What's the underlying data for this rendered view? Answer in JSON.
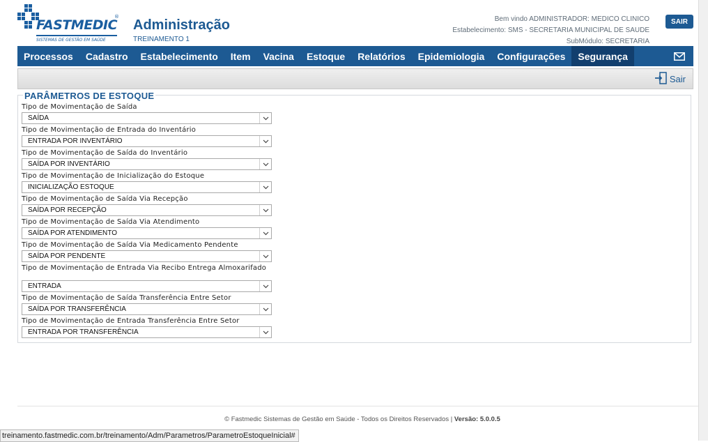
{
  "brand": {
    "logo_text": "FASTMEDIC",
    "logo_subtitle": "SISTEMAS DE GESTÃO EM SAÚDE",
    "registered": "®",
    "color": "#1a5ea0"
  },
  "header": {
    "title": "Administração",
    "subtitle": "TREINAMENTO 1",
    "welcome": "Bem vindo ADMINISTRADOR: MEDICO CLINICO",
    "establishment": "Estabelecimento: SMS - SECRETARIA MUNICIPAL DE SAUDE",
    "submodule": "SubMódulo: SECRETARIA",
    "logout_label": "SAIR"
  },
  "nav": {
    "items": [
      {
        "label": "Processos"
      },
      {
        "label": "Cadastro"
      },
      {
        "label": "Estabelecimento"
      },
      {
        "label": "Item"
      },
      {
        "label": "Vacina"
      },
      {
        "label": "Estoque"
      },
      {
        "label": "Relatórios"
      },
      {
        "label": "Epidemiologia"
      },
      {
        "label": "Configurações"
      },
      {
        "label": "Segurança",
        "active": true
      }
    ],
    "mail_icon": "envelope-icon"
  },
  "toolbar": {
    "exit_label": "Sair",
    "exit_icon": "exit-door-icon"
  },
  "panel": {
    "title": "PARÂMETROS DE ESTOQUE",
    "fields": [
      {
        "label": "Tipo de Movimentação de Saída",
        "value": "SAÍDA"
      },
      {
        "label": "Tipo de Movimentação de Entrada do Inventário",
        "value": "ENTRADA POR INVENTÁRIO"
      },
      {
        "label": "Tipo de Movimentação de Saída do Inventário",
        "value": "SAÍDA POR INVENTÁRIO"
      },
      {
        "label": "Tipo de Movimentação de Inicialização do Estoque",
        "value": "INICIALIZAÇÃO ESTOQUE"
      },
      {
        "label": "Tipo de Movimentação de Saída Via Recepção",
        "value": "SAÍDA POR RECEPÇÃO"
      },
      {
        "label": "Tipo de Movimentação de Saída Via Atendimento",
        "value": "SAÍDA POR ATENDIMENTO"
      },
      {
        "label": "Tipo de Movimentação de Saída Via Medicamento Pendente",
        "value": "SAÍDA POR PENDENTE"
      },
      {
        "label": "Tipo de Movimentação de Entrada Via Recibo Entrega Almoxarifado",
        "value": "ENTRADA"
      },
      {
        "label": "Tipo de Movimentação de Saída Transferência Entre Setor",
        "value": "SAÍDA POR TRANSFERÊNCIA"
      },
      {
        "label": "Tipo de Movimentação de Entrada Transferência Entre Setor",
        "value": "ENTRADA POR TRANSFERÊNCIA"
      }
    ]
  },
  "footer": {
    "text": "© Fastmedic Sistemas de Gestão em Saúde - Todos os Direitos Reservados | ",
    "version": "Versão: 5.0.0.5"
  },
  "status_bar": {
    "url": "treinamento.fastmedic.com.br/treinamento/Adm/Parametros/ParametroEstoqueInicial#"
  }
}
